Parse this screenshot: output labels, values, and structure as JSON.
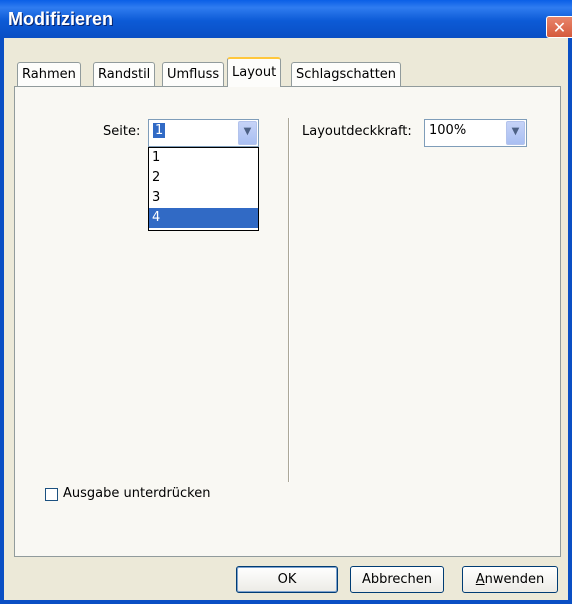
{
  "window": {
    "title": "Modifizieren",
    "close_glyph": "✕"
  },
  "tabs": [
    {
      "label": "Rahmen",
      "active": false
    },
    {
      "label": "Randstil",
      "active": false
    },
    {
      "label": "Umfluss",
      "active": false
    },
    {
      "label": "Layout",
      "active": true
    },
    {
      "label": "Schlagschatten",
      "active": false
    }
  ],
  "layout": {
    "page_label": "Seite:",
    "page_value": "1",
    "page_options": [
      "1",
      "2",
      "3",
      "4"
    ],
    "page_highlighted_option": "4",
    "opacity_label": "Layoutdeckkraft:",
    "opacity_value": "100%",
    "suppress_output_label": "Ausgabe unterdrücken",
    "suppress_output_checked": false
  },
  "buttons": {
    "ok": "OK",
    "cancel": "Abbrechen",
    "apply_accel": "A",
    "apply_rest": "nwenden"
  },
  "icons": {
    "dropdown_arrow": "chevron-down-icon",
    "close": "close-icon"
  },
  "colors": {
    "titlebar": "#0a5fe6",
    "selection": "#316ac5",
    "tab_accent": "#ffc73c",
    "dialog_bg": "#ece9d8"
  }
}
